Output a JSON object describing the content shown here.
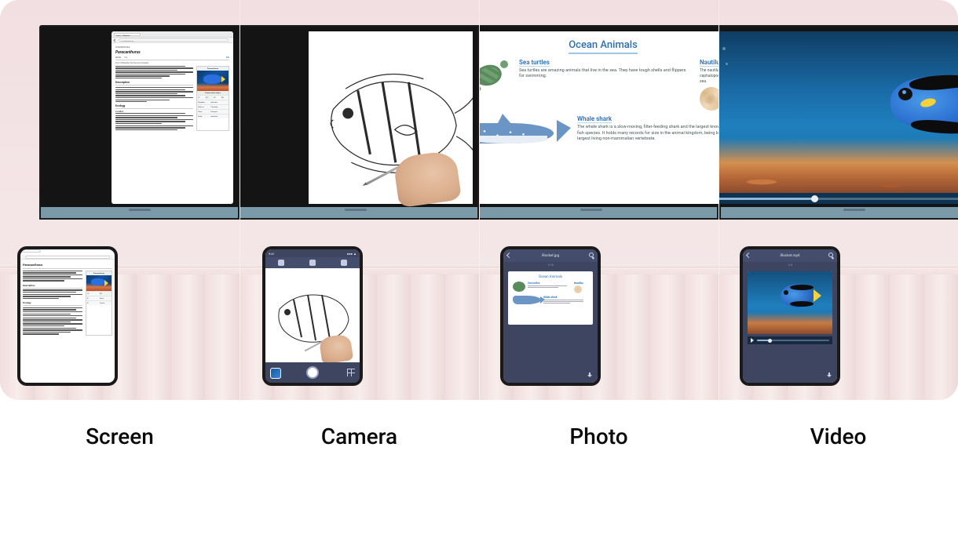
{
  "captions": [
    "Screen",
    "Camera",
    "Photo",
    "Video"
  ],
  "wikipedia": {
    "tab_label": "Suomi - Wikipedia",
    "url": "en.wikipedia.org",
    "site": "WIKIPEDIA",
    "article_title": "Paracanthurus",
    "subtitle": "From Wikipedia, the free encyclopedia",
    "infobox_header": "Paracanthurus",
    "status_label": "Conservation status",
    "section_desc": "Description",
    "section_eco": "Ecology",
    "edit": "Edit"
  },
  "camera": {
    "time": "9:41"
  },
  "slide": {
    "title": "Ocean Animals",
    "turtle_hdr": "Sea turtles",
    "turtle_body": "Sea turtles are amazing animals that live in the sea. They have tough shells and flippers for swimming.",
    "naut_hdr": "Nautilus",
    "naut_body": "The nautilus is a cephalopod of the sea.",
    "shark_hdr": "Whale shark",
    "shark_body": "The whale shark is a slow-moving, filter-feeding shark and the largest known extant fish species. It holds many records for size in the animal kingdom, being by far the largest living non-mammalian vertebrate."
  },
  "photo_file": {
    "name": "iRocket.jpg",
    "meta": "1/16"
  },
  "video_file": {
    "name": "iRocket.mp4",
    "meta": "1/4"
  }
}
